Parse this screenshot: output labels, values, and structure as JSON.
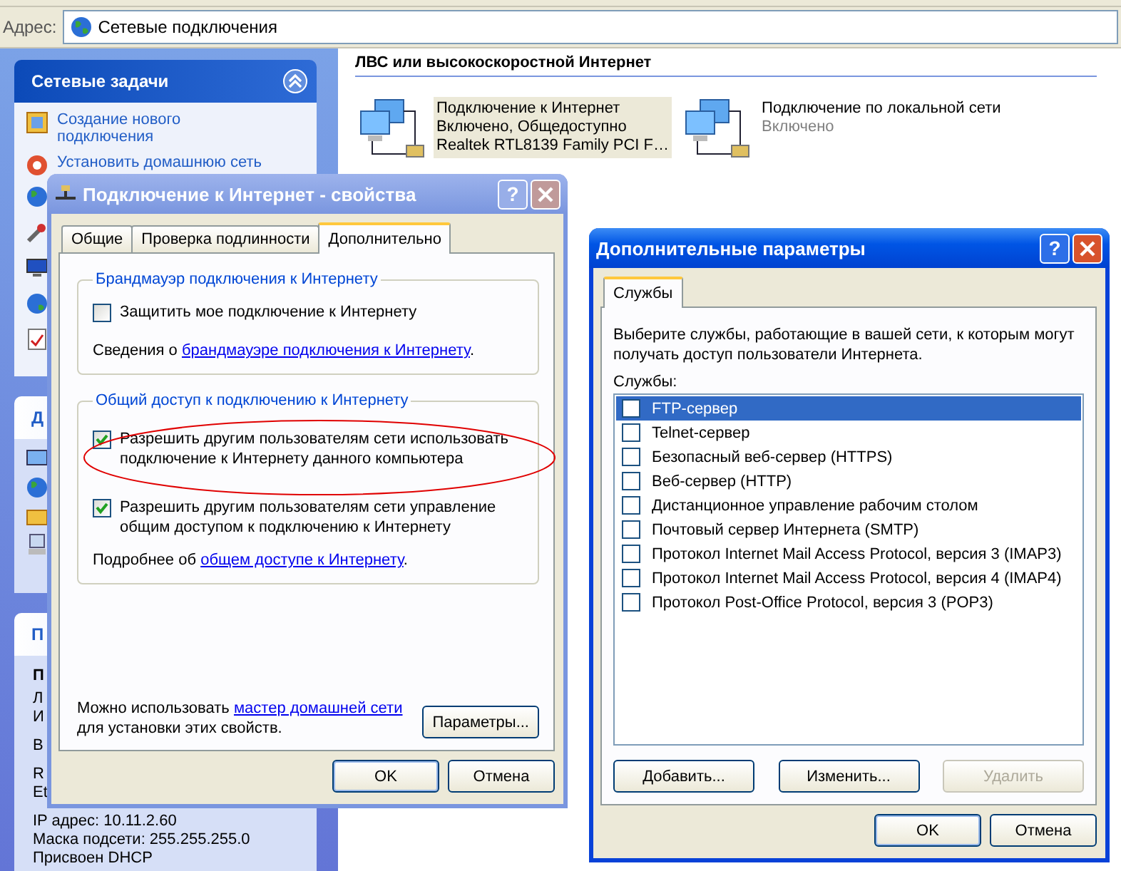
{
  "address_bar": {
    "label": "Адрес:",
    "value": "Сетевые подключения"
  },
  "task_pane": {
    "network_tasks": {
      "title": "Сетевые задачи",
      "expanded": true,
      "items": [
        "Создание нового подключения",
        "Установить домашнюю сеть"
      ]
    },
    "other_places": {
      "title": "Д"
    },
    "details": {
      "title": "П",
      "lines": [
        {
          "text": "П",
          "kind": "heading"
        },
        {
          "text": "Л",
          "kind": "line"
        },
        {
          "text": "И",
          "kind": "line"
        },
        {
          "text": "В",
          "kind": "gap"
        },
        {
          "text": "R",
          "kind": "gap"
        },
        {
          "text": "Et",
          "kind": "line"
        },
        {
          "text": "IP адрес: 10.11.2.60",
          "kind": "gap"
        },
        {
          "text": "Маска подсети: 255.255.255.0",
          "kind": "line"
        },
        {
          "text": "Присвоен DHCP",
          "kind": "line"
        }
      ]
    }
  },
  "connections": {
    "group": "ЛВС или высокоскоростной Интернет",
    "items": [
      {
        "name": "Подключение к Интернет",
        "details": [
          "Включено, Общедоступно",
          "Realtek RTL8139 Family PCI F…"
        ],
        "selected": true
      },
      {
        "name": "Подключение по локальной сети",
        "details": [
          "Включено"
        ],
        "selected": false
      }
    ]
  },
  "properties_dialog": {
    "title": "Подключение к Интернет - свойства",
    "active": false,
    "help": "?",
    "tabs": [
      {
        "label": "Общие",
        "selected": false
      },
      {
        "label": "Проверка подлинности",
        "selected": false
      },
      {
        "label": "Дополнительно",
        "selected": true
      }
    ],
    "firewall": {
      "title": "Брандмауэр подключения к Интернету",
      "option": {
        "label": "Защитить мое подключение к Интернету",
        "checked": false
      },
      "info": {
        "prefix": "Сведения о ",
        "link": "брандмауэре подключения к Интернету",
        "suffix": "."
      }
    },
    "sharing": {
      "title": "Общий доступ к подключению к Интернету",
      "options": [
        {
          "label": "Разрешить другим пользователям сети использовать подключение к Интернету данного компьютера",
          "checked": true
        },
        {
          "label": "Разрешить другим пользователям сети управление общим доступом к подключению к Интернету",
          "checked": true
        }
      ],
      "info": {
        "prefix": "Подробнее об ",
        "link": "общем доступе к Интернету",
        "suffix": "."
      }
    },
    "footer": {
      "prefix": "Можно использовать ",
      "link": "мастер домашней сети",
      "suffix": " для установки этих свойств."
    },
    "settings_button": "Параметры...",
    "buttons": [
      "OK",
      "Отмена"
    ]
  },
  "advanced_dialog": {
    "title": "Дополнительные параметры",
    "active": true,
    "help": "?",
    "tabs": [
      {
        "label": "Службы",
        "selected": true
      }
    ],
    "description": "Выберите службы, работающие в вашей сети, к которым могут получать доступ пользователи Интернета.",
    "list_label": "Службы:",
    "services": [
      {
        "label": "FTP-сервер",
        "checked": false,
        "selected": true
      },
      {
        "label": "Telnet-сервер",
        "checked": false,
        "selected": false
      },
      {
        "label": "Безопасный веб-сервер (HTTPS)",
        "checked": false,
        "selected": false
      },
      {
        "label": "Веб-сервер (HTTP)",
        "checked": false,
        "selected": false
      },
      {
        "label": "Дистанционное управление рабочим столом",
        "checked": false,
        "selected": false
      },
      {
        "label": "Почтовый сервер Интернета (SMTP)",
        "checked": false,
        "selected": false
      },
      {
        "label": "Протокол Internet Mail Access Protocol, версия 3 (IMAP3)",
        "checked": false,
        "selected": false
      },
      {
        "label": "Протокол Internet Mail Access Protocol, версия 4 (IMAP4)",
        "checked": false,
        "selected": false
      },
      {
        "label": "Протокол Post-Office Protocol, версия 3 (POP3)",
        "checked": false,
        "selected": false
      }
    ],
    "list_buttons": [
      {
        "label": "Добавить...",
        "disabled": false
      },
      {
        "label": "Изменить...",
        "disabled": false
      },
      {
        "label": "Удалить",
        "disabled": true
      }
    ],
    "buttons": [
      "OK",
      "Отмена"
    ]
  }
}
